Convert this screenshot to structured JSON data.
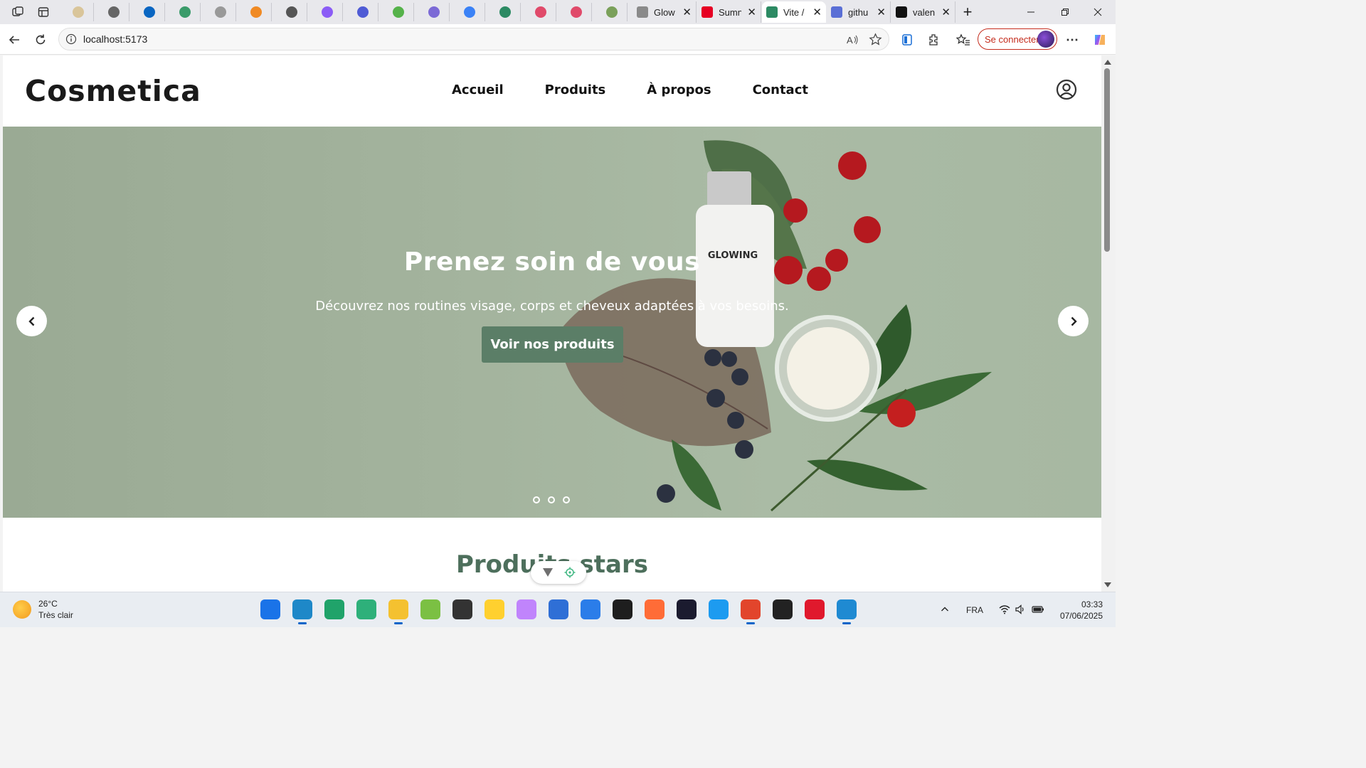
{
  "browser": {
    "tabs": [
      {
        "title": "Glow",
        "favicon_color": "#8a8a8a"
      },
      {
        "title": "Sumn",
        "favicon_color": "#e60023"
      },
      {
        "title": "Vite /",
        "favicon_color": "#2c8a63",
        "active": true
      },
      {
        "title": "githu",
        "favicon_color": "#5a6fd6"
      },
      {
        "title": "valen",
        "favicon_color": "#111111"
      }
    ],
    "pinned_favicons": [
      "#d9c59a",
      "#666666",
      "#0a66c2",
      "#3a9b6a",
      "#999999",
      "#f08a24",
      "#555555",
      "#8b5cf6",
      "#4f5bd5",
      "#55b24a",
      "#7c6ad6",
      "#3b82f6",
      "#2c8a63",
      "#e04a6a",
      "#e04a6a",
      "#7aa05a"
    ],
    "url": "localhost:5173",
    "signin_label": "Se connecter",
    "new_tab_symbol": "+",
    "close_symbol": "✕"
  },
  "site": {
    "logo": "Cosmetica",
    "nav": [
      "Accueil",
      "Produits",
      "À propos",
      "Contact"
    ],
    "hero": {
      "title": "Prenez soin de vous",
      "subtitle": "Découvrez nos routines visage, corps et cheveux adaptées à vos besoins.",
      "cta": "Voir nos produits",
      "bottle_label": "GLOWING",
      "slides": 3,
      "active_slide": 2
    },
    "section_title": "Produits stars"
  },
  "taskbar": {
    "weather_temp": "26°C",
    "weather_desc": "Très clair",
    "language": "FRA",
    "time": "03:33",
    "date": "07/06/2025"
  },
  "colors": {
    "accent_green": "#5b7e67",
    "section_title": "#4d6f5c",
    "signin_red": "#c42b1c"
  }
}
